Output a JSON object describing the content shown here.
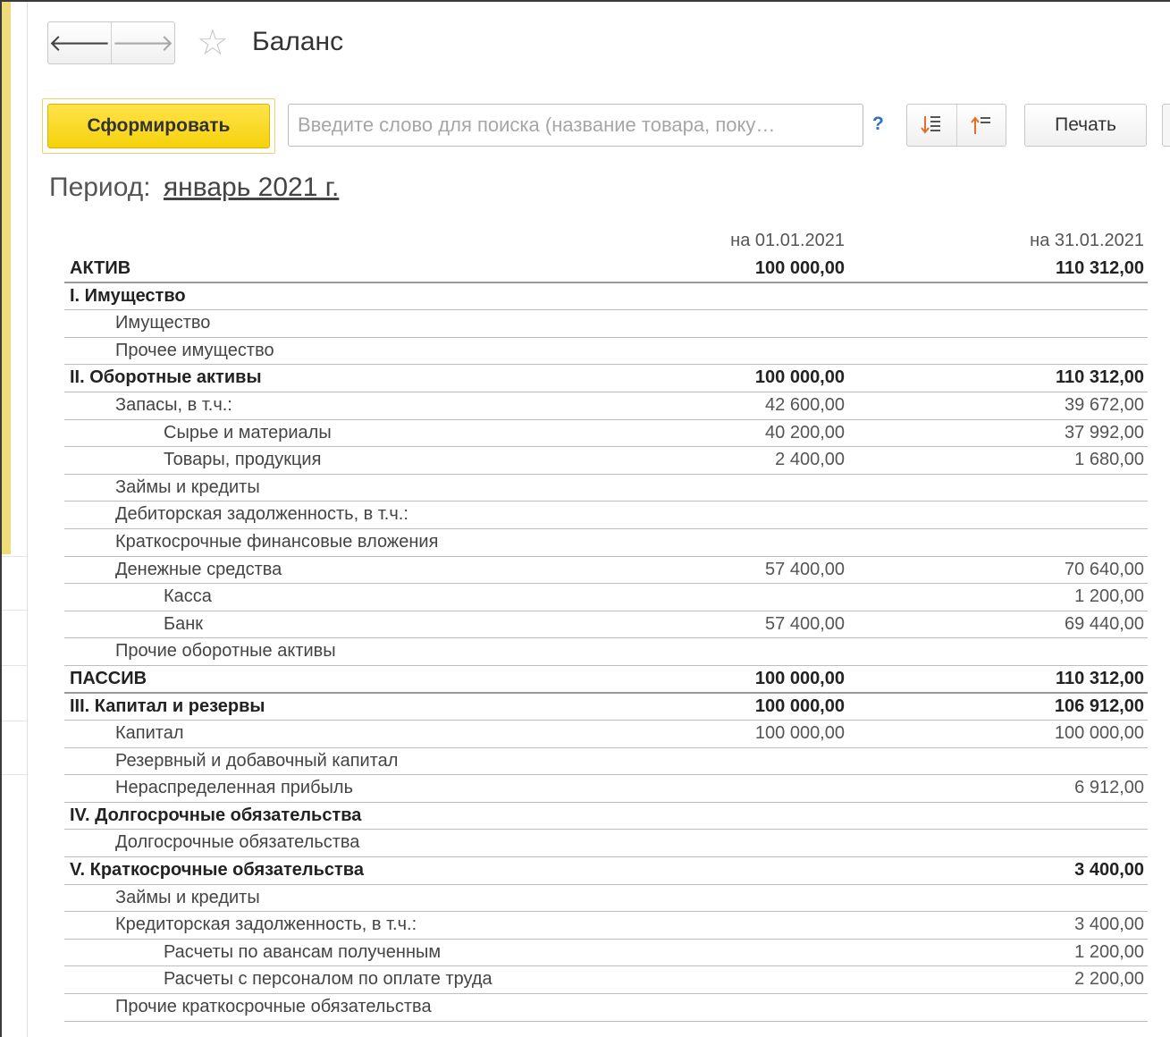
{
  "window": {
    "title": "Баланс"
  },
  "toolbar": {
    "generate_label": "Сформировать",
    "search_placeholder": "Введите слово для поиска (название товара, поку…",
    "help_label": "?",
    "print_label": "Печать"
  },
  "period": {
    "label": "Период:",
    "value": "январь 2021 г."
  },
  "report": {
    "col1_header": "на 01.01.2021",
    "col2_header": "на 31.01.2021",
    "rows": [
      {
        "label": "АКТИВ",
        "v1": "100 000,00",
        "v2": "110 312,00"
      },
      {
        "label": "I. Имущество",
        "v1": "",
        "v2": ""
      },
      {
        "label": "Имущество",
        "v1": "",
        "v2": ""
      },
      {
        "label": "Прочее имущество",
        "v1": "",
        "v2": ""
      },
      {
        "label": "II. Оборотные активы",
        "v1": "100 000,00",
        "v2": "110 312,00"
      },
      {
        "label": "Запасы, в т.ч.:",
        "v1": "42 600,00",
        "v2": "39 672,00"
      },
      {
        "label": "Сырье и материалы",
        "v1": "40 200,00",
        "v2": "37 992,00"
      },
      {
        "label": "Товары, продукция",
        "v1": "2 400,00",
        "v2": "1 680,00"
      },
      {
        "label": "Займы и кредиты",
        "v1": "",
        "v2": ""
      },
      {
        "label": "Дебиторская задолженность, в т.ч.:",
        "v1": "",
        "v2": ""
      },
      {
        "label": "Краткосрочные финансовые вложения",
        "v1": "",
        "v2": ""
      },
      {
        "label": "Денежные средства",
        "v1": "57 400,00",
        "v2": "70 640,00"
      },
      {
        "label": "Касса",
        "v1": "",
        "v2": "1 200,00"
      },
      {
        "label": "Банк",
        "v1": "57 400,00",
        "v2": "69 440,00"
      },
      {
        "label": "Прочие оборотные активы",
        "v1": "",
        "v2": ""
      },
      {
        "label": "ПАССИВ",
        "v1": "100 000,00",
        "v2": "110 312,00"
      },
      {
        "label": "III. Капитал и резервы",
        "v1": "100 000,00",
        "v2": "106 912,00"
      },
      {
        "label": "Капитал",
        "v1": "100 000,00",
        "v2": "100 000,00"
      },
      {
        "label": "Резервный и добавочный капитал",
        "v1": "",
        "v2": ""
      },
      {
        "label": "Нераспределенная прибыль",
        "v1": "",
        "v2": "6 912,00"
      },
      {
        "label": "IV. Долгосрочные обязательства",
        "v1": "",
        "v2": ""
      },
      {
        "label": "Долгосрочные обязательства",
        "v1": "",
        "v2": ""
      },
      {
        "label": "V. Краткосрочные обязательства",
        "v1": "",
        "v2": "3 400,00"
      },
      {
        "label": "Займы и кредиты",
        "v1": "",
        "v2": ""
      },
      {
        "label": "Кредиторская задолженность, в т.ч.:",
        "v1": "",
        "v2": "3 400,00"
      },
      {
        "label": "Расчеты по авансам полученным",
        "v1": "",
        "v2": "1 200,00"
      },
      {
        "label": "Расчеты с персоналом по оплате труда",
        "v1": "",
        "v2": "2 200,00"
      },
      {
        "label": "Прочие краткосрочные обязательства",
        "v1": "",
        "v2": ""
      }
    ]
  }
}
